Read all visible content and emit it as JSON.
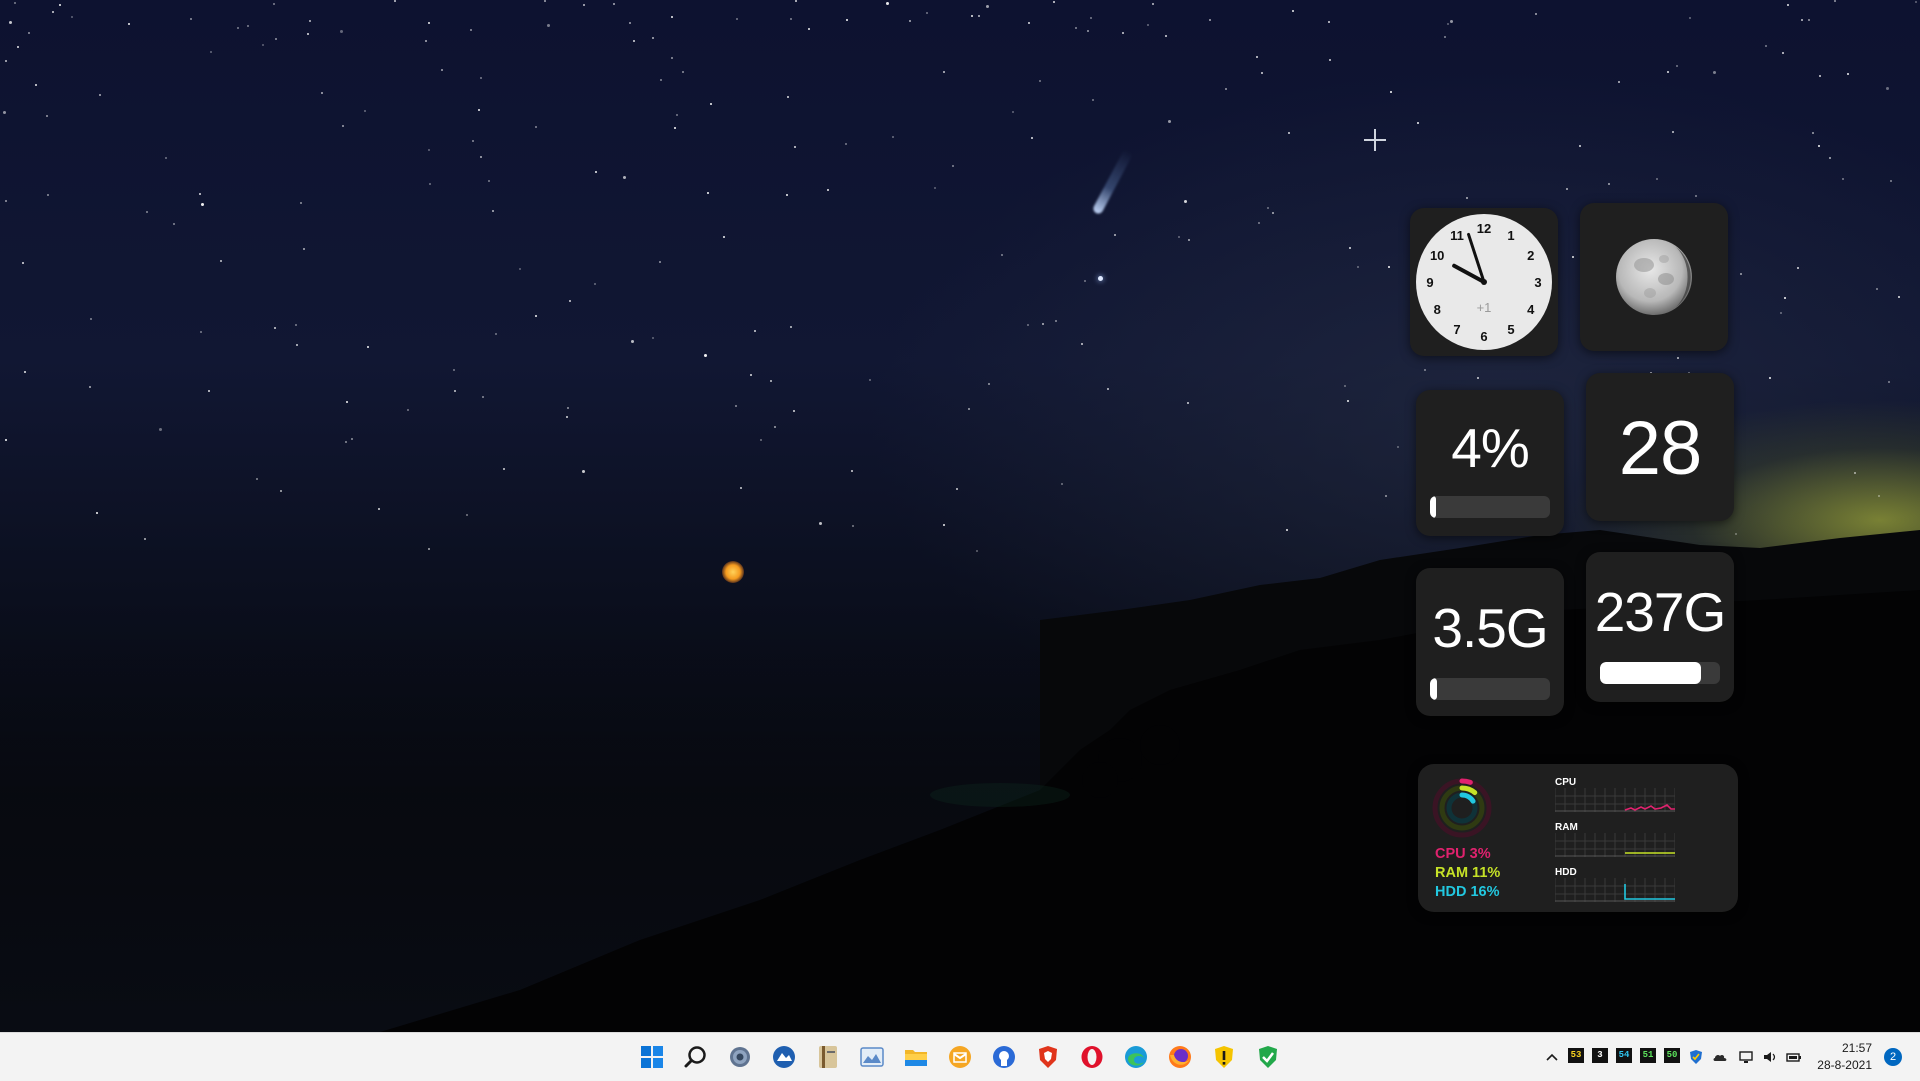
{
  "desktop": {
    "add_widget_icon": "plus-icon"
  },
  "widgets": {
    "clock": {
      "numbers": [
        "12",
        "1",
        "2",
        "3",
        "4",
        "5",
        "6",
        "7",
        "8",
        "9",
        "10",
        "11"
      ],
      "timezone_offset": "+1",
      "hour": 21,
      "minute": 57
    },
    "moon": {
      "icon": "moon-icon"
    },
    "cpu": {
      "value": "4%",
      "fraction": 0.04
    },
    "date": {
      "value": "28"
    },
    "ram": {
      "value": "3.5G",
      "fraction": 0.06
    },
    "disk": {
      "value": "237G",
      "fraction": 0.84
    },
    "system": {
      "cpu_label": "CPU 3%",
      "ram_label": "RAM 11%",
      "hdd_label": "HDD 16%",
      "cpu_fraction": 0.03,
      "ram_fraction": 0.11,
      "hdd_fraction": 0.16,
      "graph_cpu_title": "CPU",
      "graph_ram_title": "RAM",
      "graph_hdd_title": "HDD",
      "colors": {
        "cpu": "#e0226e",
        "ram": "#c6e227",
        "hdd": "#22c8e0"
      }
    }
  },
  "taskbar": {
    "apps": [
      "windows-start-icon",
      "search-icon",
      "settings-icon",
      "camera-app-icon",
      "notebook-icon",
      "photos-icon",
      "file-explorer-icon",
      "mail-icon",
      "github-icon",
      "brave-icon",
      "opera-icon",
      "edge-icon",
      "firefox-icon",
      "security-warning-icon",
      "shield-check-icon"
    ],
    "tray": {
      "overflow_icon": "chevron-up-icon",
      "temp_1": "53",
      "temp_2": "3",
      "temp_3": "54",
      "temp_4": "51",
      "temp_5": "50",
      "icons": [
        "defender-icon",
        "onedrive-icon",
        "network-icon",
        "volume-icon",
        "battery-icon"
      ]
    },
    "clock": {
      "time": "21:57",
      "date": "28-8-2021"
    },
    "notifications": "2"
  }
}
